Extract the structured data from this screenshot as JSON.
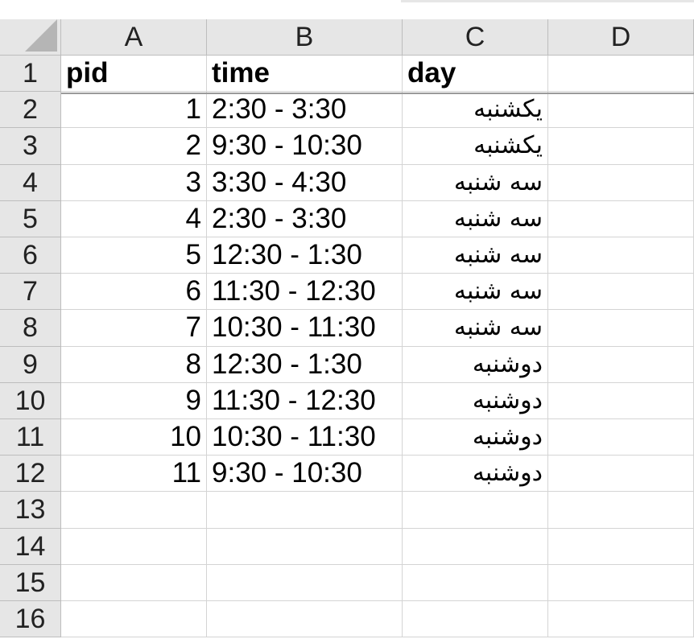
{
  "columns": [
    "A",
    "B",
    "C",
    "D"
  ],
  "row_numbers": [
    "1",
    "2",
    "3",
    "4",
    "5",
    "6",
    "7",
    "8",
    "9",
    "10",
    "11",
    "12",
    "13",
    "14",
    "15",
    "16"
  ],
  "header": {
    "pid": "pid",
    "time": "time",
    "day": "day"
  },
  "rows": [
    {
      "pid": "1",
      "time": "2:30 - 3:30",
      "day": "یکشنبه"
    },
    {
      "pid": "2",
      "time": "9:30 - 10:30",
      "day": "یکشنبه"
    },
    {
      "pid": "3",
      "time": "3:30 - 4:30",
      "day": "سه شنبه"
    },
    {
      "pid": "4",
      "time": "2:30 - 3:30",
      "day": "سه شنبه"
    },
    {
      "pid": "5",
      "time": "12:30 - 1:30",
      "day": "سه شنبه"
    },
    {
      "pid": "6",
      "time": "11:30 - 12:30",
      "day": "سه شنبه"
    },
    {
      "pid": "7",
      "time": "10:30 - 11:30",
      "day": "سه شنبه"
    },
    {
      "pid": "8",
      "time": "12:30 - 1:30",
      "day": "دوشنبه"
    },
    {
      "pid": "9",
      "time": "11:30 - 12:30",
      "day": "دوشنبه"
    },
    {
      "pid": "10",
      "time": "10:30 - 11:30",
      "day": "دوشنبه"
    },
    {
      "pid": "11",
      "time": "9:30 - 10:30",
      "day": "دوشنبه"
    }
  ]
}
